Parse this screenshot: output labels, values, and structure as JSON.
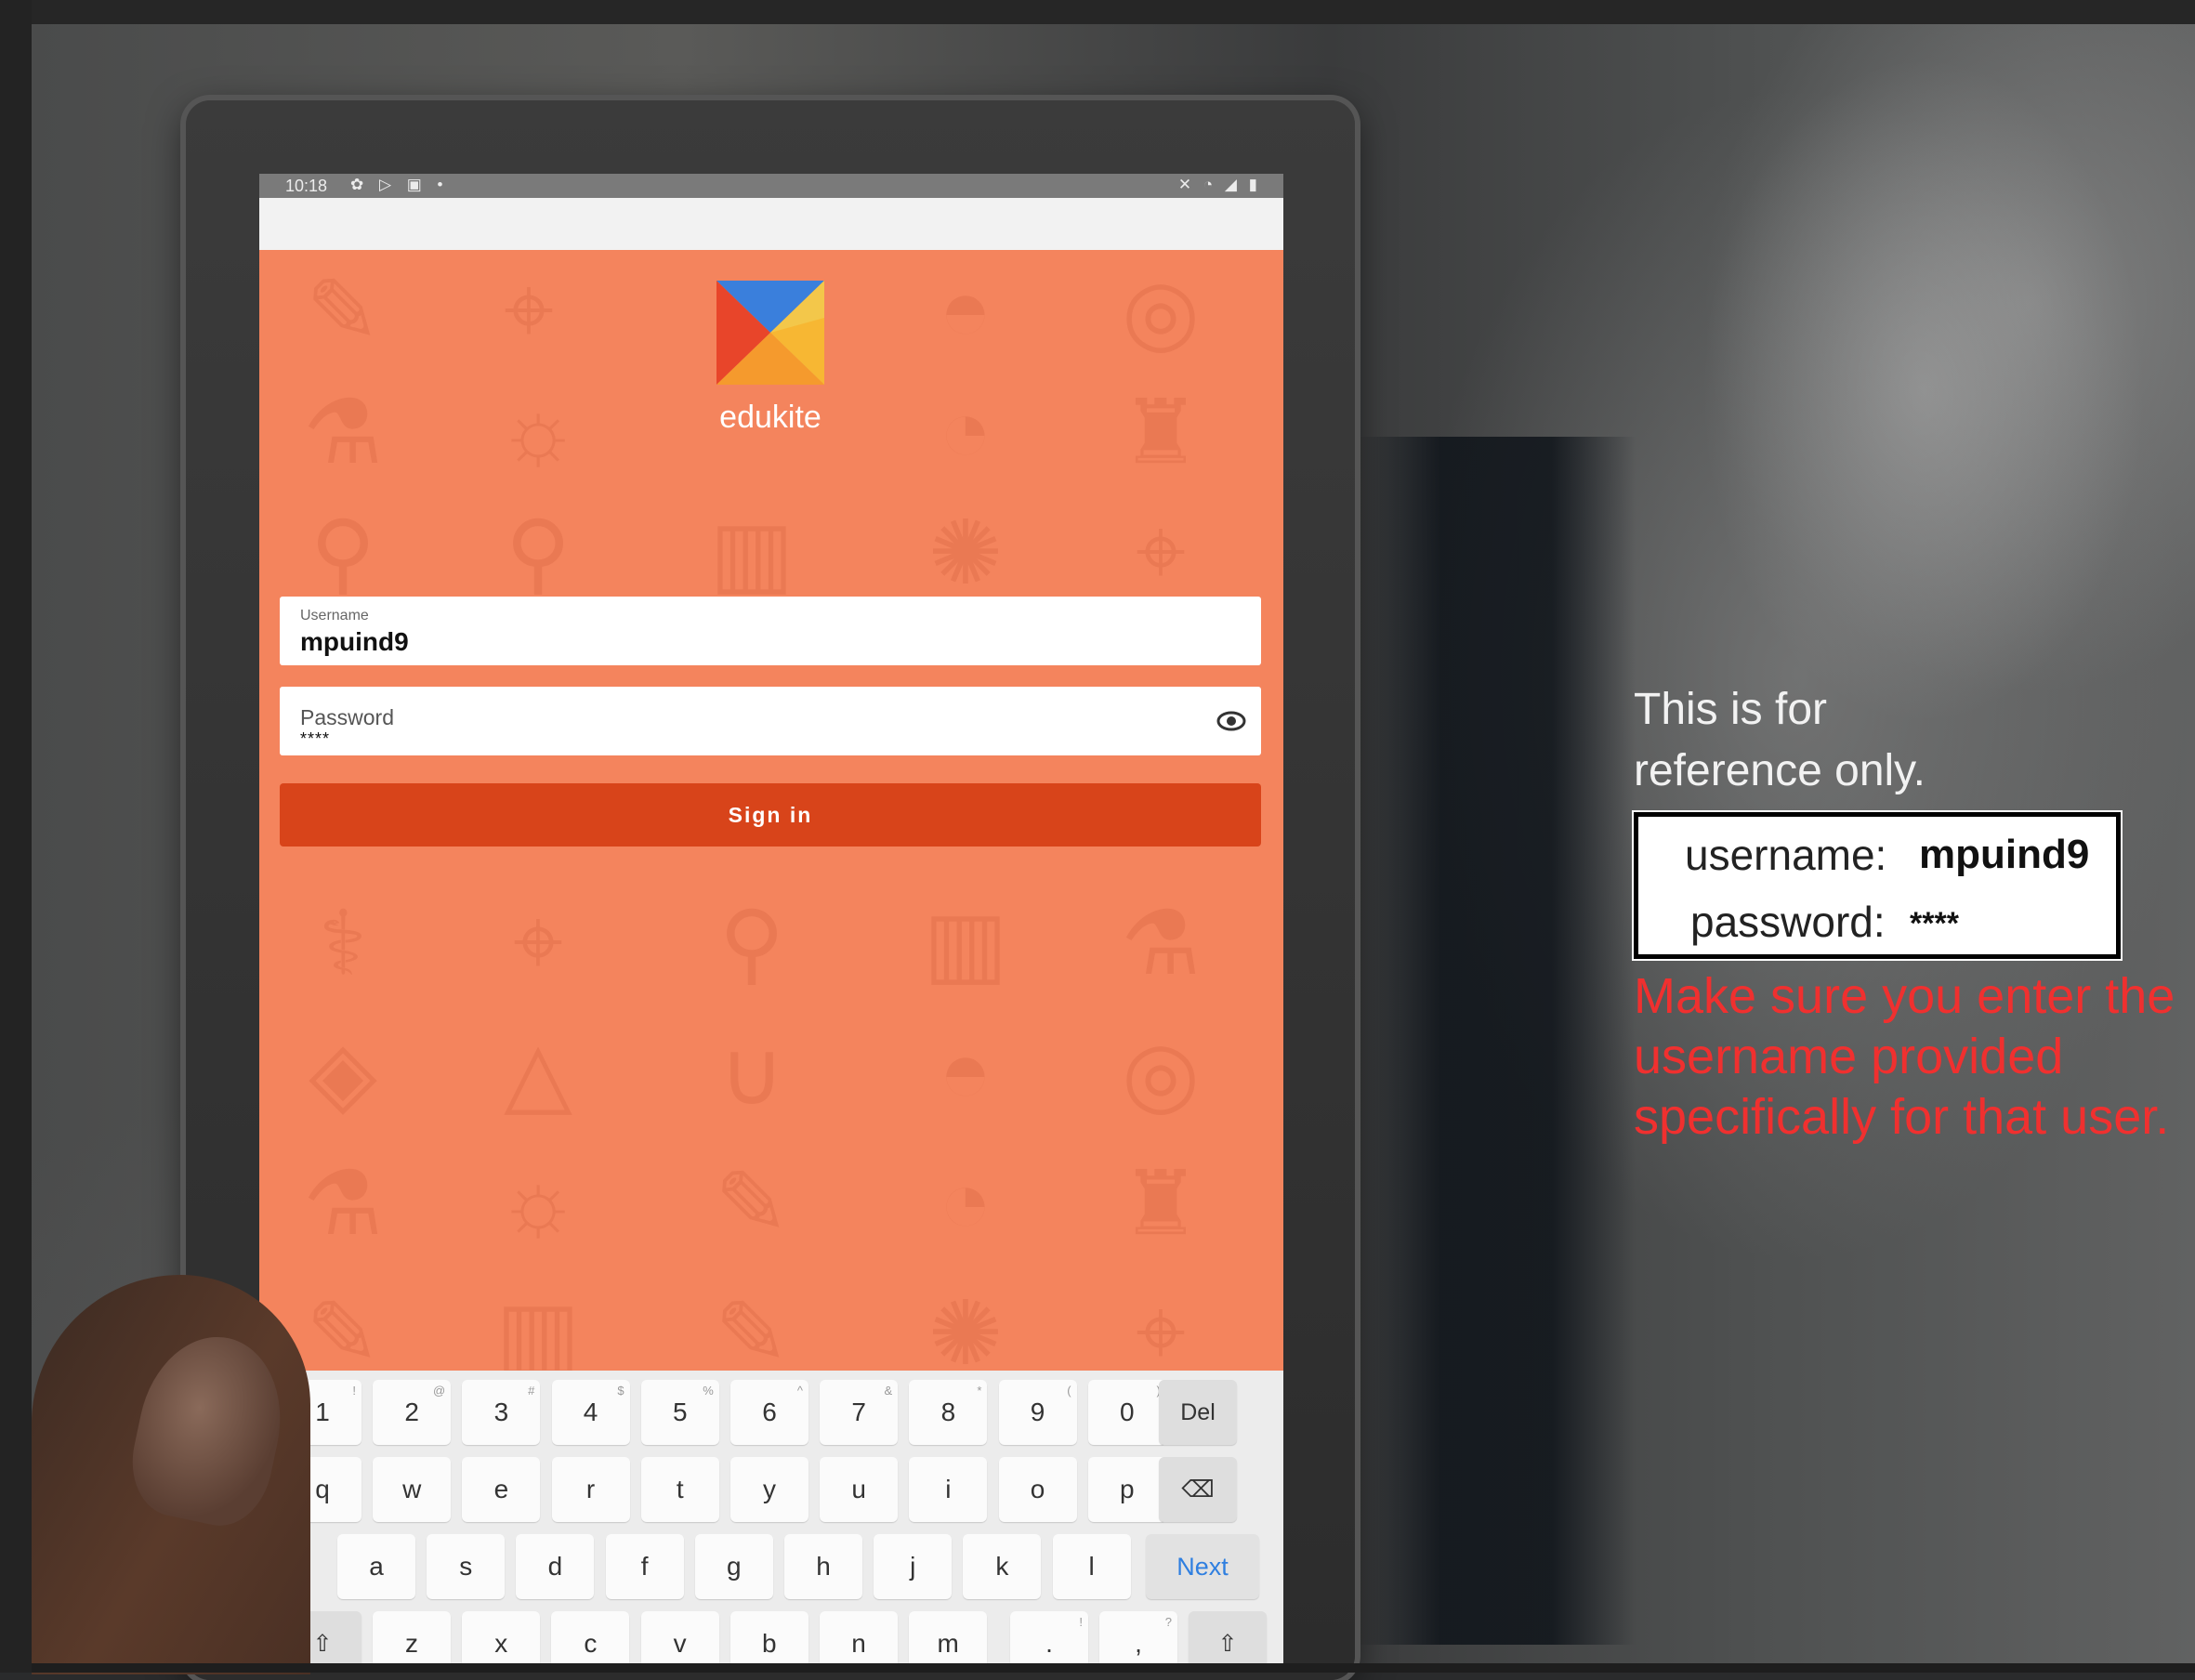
{
  "status_bar": {
    "time": "10:18",
    "left_icons": "✿ ▷ ▣ •",
    "right_icons": "✕ ◔ ◢ ▮"
  },
  "app": {
    "brand": "edukite"
  },
  "form": {
    "username_label": "Username",
    "username_value": "mpuind9",
    "password_label": "Password",
    "password_value": "****",
    "signin_label": "Sign in"
  },
  "keyboard": {
    "row1": [
      {
        "k": "1",
        "s": "!"
      },
      {
        "k": "2",
        "s": "@"
      },
      {
        "k": "3",
        "s": "#"
      },
      {
        "k": "4",
        "s": "$"
      },
      {
        "k": "5",
        "s": "%"
      },
      {
        "k": "6",
        "s": "^"
      },
      {
        "k": "7",
        "s": "&"
      },
      {
        "k": "8",
        "s": "*"
      },
      {
        "k": "9",
        "s": "("
      },
      {
        "k": "0",
        "s": ")"
      }
    ],
    "row2": [
      "q",
      "w",
      "e",
      "r",
      "t",
      "y",
      "u",
      "i",
      "o",
      "p"
    ],
    "row3": [
      "a",
      "s",
      "d",
      "f",
      "g",
      "h",
      "j",
      "k",
      "l"
    ],
    "row4": [
      "z",
      "x",
      "c",
      "v",
      "b",
      "n",
      "m"
    ],
    "del_label": "Del",
    "next_label": "Next",
    "backspace_icon": "⌫",
    "shift_icon": "⇧",
    "punct1": ".",
    "punct1_sup": "!",
    "punct2": ",",
    "punct2_sup": "?"
  },
  "note": {
    "line1": "This is for",
    "line2": "reference only.",
    "username_label": "username:",
    "username_value": "mpuind9",
    "password_label": "password:",
    "password_value": "****",
    "warning": "Make sure you enter the username provided specifically for that user."
  },
  "colors": {
    "screen_bg": "#f4845d",
    "signin_bg": "#d8441a",
    "warning_text": "#f0302f",
    "next_key": "#2f7fe0"
  },
  "icons": {
    "eye": "eye-icon",
    "logo": "edukite-logo-icon"
  }
}
